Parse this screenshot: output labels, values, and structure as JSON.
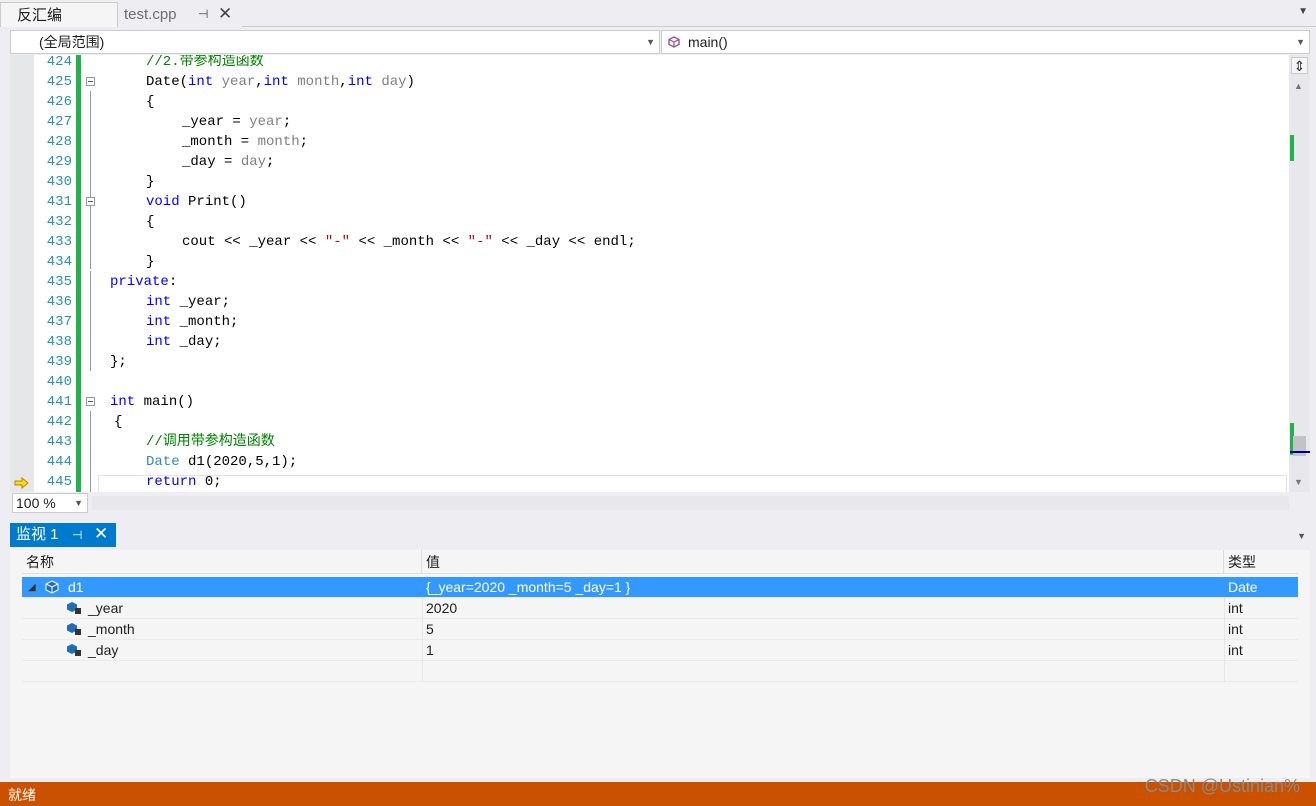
{
  "doc_tabs": {
    "tab1_label": "反汇编",
    "tab2_label": "test.cpp"
  },
  "nav": {
    "scope": "(全局范围)",
    "member": "main()"
  },
  "editor": {
    "lines": [
      {
        "n": "424"
      },
      {
        "n": "425"
      },
      {
        "n": "426"
      },
      {
        "n": "427"
      },
      {
        "n": "428"
      },
      {
        "n": "429"
      },
      {
        "n": "430"
      },
      {
        "n": "431"
      },
      {
        "n": "432"
      },
      {
        "n": "433"
      },
      {
        "n": "434"
      },
      {
        "n": "435"
      },
      {
        "n": "436"
      },
      {
        "n": "437"
      },
      {
        "n": "438"
      },
      {
        "n": "439"
      },
      {
        "n": "440"
      },
      {
        "n": "441"
      },
      {
        "n": "442"
      },
      {
        "n": "443"
      },
      {
        "n": "444"
      },
      {
        "n": "445"
      }
    ],
    "code": {
      "l424": "//2.带参构造函数",
      "l425_fn": "Date(",
      "l425_kw1": "int",
      "l425_p1": "year",
      "l425_kw2": "int",
      "l425_p2": "month",
      "l425_kw3": "int",
      "l425_p3": "day",
      "l426": "{",
      "l427_lhs": "_year = ",
      "l427_rhs": "year",
      "l428_lhs": "_month = ",
      "l428_rhs": "month",
      "l429_lhs": "_day = ",
      "l429_rhs": "day",
      "l430": "}",
      "l431_kw": "void",
      "l431_rest": " Print()",
      "l432": "{",
      "l433_a": "cout << _year << ",
      "l433_s1": "\"-\"",
      "l433_b": " << _month << ",
      "l433_s2": "\"-\"",
      "l433_c": " << _day << endl;",
      "l434": "}",
      "l435_kw": "private",
      "l435_rest": ":",
      "l436_kw": "int",
      "l436_rest": " _year;",
      "l437_kw": "int",
      "l437_rest": " _month;",
      "l438_kw": "int",
      "l438_rest": " _day;",
      "l439": "};",
      "l441_kw": "int",
      "l441_rest": " main()",
      "l442": "{",
      "l443": "//调用带参构造函数",
      "l444_ty": "Date",
      "l444_rest": " d1(2020,5,1);",
      "l445_kw": "return",
      "l445_rest": " 0;"
    }
  },
  "zoom": {
    "level": "100 %"
  },
  "watch": {
    "tab_label": "监视 1",
    "columns": [
      "名称",
      "值",
      "类型"
    ],
    "rows": [
      {
        "name": "d1",
        "value": "{_year=2020 _month=5 _day=1 }",
        "type": "Date"
      },
      {
        "name": "_year",
        "value": "2020",
        "type": "int"
      },
      {
        "name": "_month",
        "value": "5",
        "type": "int"
      },
      {
        "name": "_day",
        "value": "1",
        "type": "int"
      }
    ]
  },
  "status": {
    "text": "就绪"
  },
  "watermark": "CSDN @Ustinian%",
  "colors": {
    "accent": "#007acc",
    "selection": "#3399ff",
    "status_bar": "#ca5100",
    "change_margin": "#22b14c"
  },
  "icons": [
    "pin-icon",
    "close-icon",
    "cube-icon",
    "split-icon",
    "execution-arrow-icon",
    "expander-icon",
    "variable-icon"
  ]
}
